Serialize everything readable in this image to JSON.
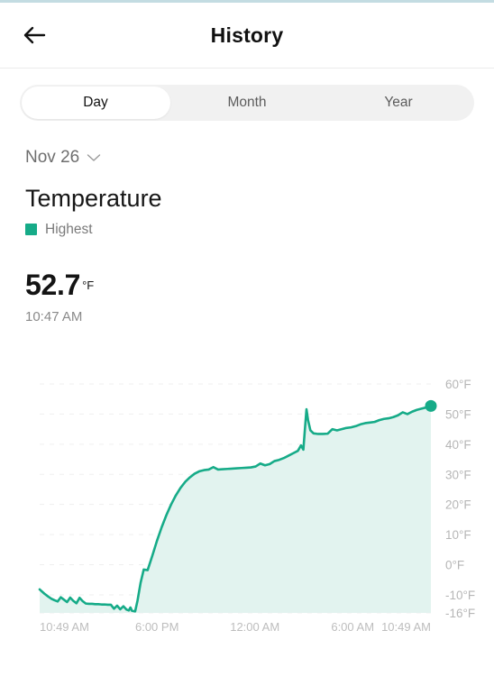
{
  "header": {
    "title": "History",
    "back_icon": "arrow-left-icon"
  },
  "tabs": {
    "items": [
      {
        "label": "Day",
        "active": true
      },
      {
        "label": "Month",
        "active": false
      },
      {
        "label": "Year",
        "active": false
      }
    ]
  },
  "info": {
    "date": "Nov 26",
    "date_chevron_icon": "chevron-down-icon",
    "metric_title": "Temperature",
    "legend_label": "Highest",
    "legend_color": "#16ab88",
    "value": "52.7",
    "unit": "°F",
    "time": "10:47 AM"
  },
  "chart_data": {
    "type": "area",
    "title": "Temperature",
    "xlabel": "",
    "ylabel": "°F",
    "legend": [
      "Highest"
    ],
    "legend_position": "above-chart",
    "grid": true,
    "line_color": "#16ab88",
    "fill_color": "#e2f3ef",
    "ylim": [
      -16,
      60
    ],
    "yticks": [
      60,
      50,
      40,
      30,
      20,
      10,
      0,
      -10,
      -16
    ],
    "ytick_labels": [
      "60°F",
      "50°F",
      "40°F",
      "30°F",
      "20°F",
      "10°F",
      "0°F",
      "-10°F",
      "-16°F"
    ],
    "xtick_labels": [
      "10:49 AM",
      "6:00 PM",
      "12:00 AM",
      "6:00 AM",
      "10:49 AM"
    ],
    "xtick_positions": [
      0,
      0.3,
      0.55,
      0.8,
      1.0
    ],
    "endpoint_marker": true,
    "endpoint_value": 52.7,
    "series": [
      {
        "name": "Highest",
        "x": [
          0.0,
          0.012,
          0.022,
          0.03,
          0.038,
          0.046,
          0.054,
          0.062,
          0.07,
          0.078,
          0.086,
          0.094,
          0.102,
          0.11,
          0.118,
          0.126,
          0.134,
          0.142,
          0.15,
          0.158,
          0.166,
          0.174,
          0.182,
          0.19,
          0.198,
          0.206,
          0.214,
          0.222,
          0.228,
          0.232,
          0.236,
          0.24,
          0.244,
          0.25,
          0.258,
          0.266,
          0.276,
          0.288,
          0.3,
          0.312,
          0.324,
          0.336,
          0.348,
          0.36,
          0.372,
          0.384,
          0.396,
          0.408,
          0.42,
          0.432,
          0.444,
          0.456,
          0.468,
          0.48,
          0.492,
          0.504,
          0.516,
          0.528,
          0.54,
          0.552,
          0.564,
          0.576,
          0.588,
          0.6,
          0.612,
          0.624,
          0.636,
          0.648,
          0.66,
          0.668,
          0.674,
          0.678,
          0.682,
          0.686,
          0.692,
          0.7,
          0.712,
          0.724,
          0.736,
          0.748,
          0.76,
          0.772,
          0.784,
          0.796,
          0.808,
          0.82,
          0.832,
          0.844,
          0.856,
          0.868,
          0.88,
          0.892,
          0.904,
          0.916,
          0.928,
          0.94,
          0.952,
          0.964,
          0.976,
          0.988,
          1.0
        ],
        "values": [
          -8.2,
          -9.6,
          -10.6,
          -11.3,
          -11.8,
          -12.2,
          -10.8,
          -11.6,
          -12.4,
          -10.9,
          -12.0,
          -12.8,
          -11.0,
          -12.1,
          -12.9,
          -13.0,
          -13.0,
          -13.1,
          -13.1,
          -13.2,
          -13.2,
          -13.3,
          -13.3,
          -14.6,
          -13.6,
          -14.8,
          -13.8,
          -14.9,
          -15.2,
          -14.2,
          -15.3,
          -15.4,
          -15.5,
          -12.0,
          -6.0,
          -1.6,
          -1.8,
          3.0,
          8.0,
          12.5,
          16.5,
          20.0,
          23.0,
          25.5,
          27.5,
          29.0,
          30.2,
          31.0,
          31.4,
          31.6,
          32.4,
          31.6,
          31.7,
          31.8,
          31.9,
          32.0,
          32.1,
          32.2,
          32.3,
          32.6,
          33.6,
          33.0,
          33.4,
          34.4,
          34.8,
          35.4,
          36.2,
          37.0,
          37.8,
          39.6,
          38.2,
          45.0,
          51.6,
          48.0,
          44.6,
          43.6,
          43.4,
          43.4,
          43.5,
          45.0,
          44.6,
          45.0,
          45.4,
          45.6,
          46.0,
          46.6,
          47.0,
          47.2,
          47.4,
          48.0,
          48.4,
          48.6,
          49.0,
          49.6,
          50.6,
          50.0,
          50.8,
          51.4,
          51.8,
          52.2,
          52.7
        ]
      }
    ]
  }
}
